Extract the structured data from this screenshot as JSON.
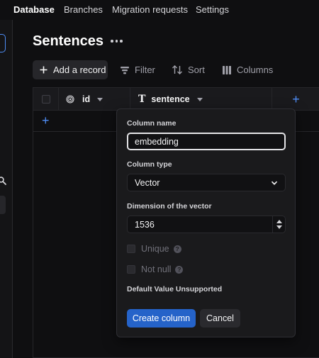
{
  "nav": {
    "items": [
      "Database",
      "Branches",
      "Migration requests",
      "Settings"
    ]
  },
  "page": {
    "title": "Sentences"
  },
  "toolbar": {
    "add_record": "Add a record",
    "filter": "Filter",
    "sort": "Sort",
    "columns": "Columns"
  },
  "table": {
    "columns": [
      {
        "name": "id",
        "icon": "id-fingerprint-icon"
      },
      {
        "name": "sentence",
        "icon": "text-type-icon"
      }
    ]
  },
  "popover": {
    "column_name_label": "Column name",
    "column_name_value": "embedding",
    "column_type_label": "Column type",
    "column_type_value": "Vector",
    "dimension_label": "Dimension of the vector",
    "dimension_value": "1536",
    "unique_label": "Unique",
    "not_null_label": "Not null",
    "help_glyph": "?",
    "default_value_note": "Default Value Unsupported",
    "create_button": "Create column",
    "cancel_button": "Cancel"
  },
  "colors": {
    "accent": "#4f8ef7",
    "primary_button": "#2563c9",
    "background": "#0f0f11",
    "panel": "#1a1a1c"
  }
}
